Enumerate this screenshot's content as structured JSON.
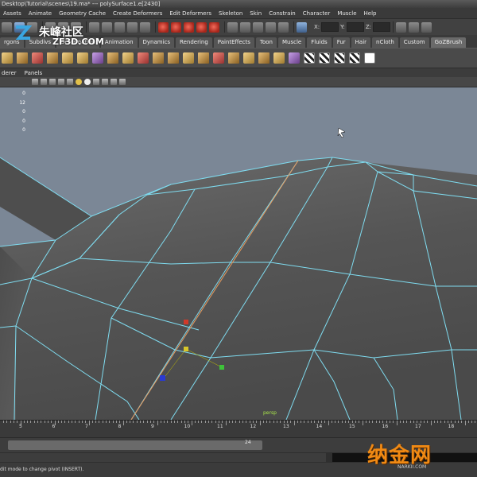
{
  "title": "Desktop\\Tutorial\\scenes\\19.ma*   ---   polySurface1.e[2430]",
  "menubar": {
    "items": [
      "Assets",
      "Animate",
      "Geometry Cache",
      "Create Deformers",
      "Edit Deformers",
      "Skeleton",
      "Skin",
      "Constrain",
      "Character",
      "Muscle",
      "Help"
    ]
  },
  "status": {
    "x_label": "X:",
    "y_label": "Y:",
    "z_label": "Z:"
  },
  "shelf_tabs": [
    "rgons",
    "Subdivs",
    "Deformation",
    "Animation",
    "Dynamics",
    "Rendering",
    "PaintEffects",
    "Toon",
    "Muscle",
    "Fluids",
    "Fur",
    "Hair",
    "nCloth",
    "Custom",
    "GoZBrush"
  ],
  "shelf_icons": [
    "y",
    "t",
    "r",
    "t",
    "y",
    "y",
    "v",
    "t",
    "y",
    "r",
    "t",
    "t",
    "y",
    "t",
    "r",
    "t",
    "y",
    "t",
    "y",
    "v",
    "c",
    "c",
    "c",
    "c",
    "w"
  ],
  "panel_menu": [
    "derer",
    "Panels"
  ],
  "hud_values": [
    "0",
    "12",
    "0",
    "0",
    "0"
  ],
  "viewport": {
    "camera_label": "persp"
  },
  "timeline": {
    "ticks": [
      "5",
      "6",
      "7",
      "8",
      "9",
      "10",
      "11",
      "12",
      "13",
      "14",
      "15",
      "16",
      "17",
      "18"
    ]
  },
  "range": {
    "current_value": "24"
  },
  "help_line": "dit mode to change pivot (INSERT).",
  "watermarks": {
    "top": "朱峰社区",
    "top_sub": "ZF3D.COM",
    "bottom": "纳金网",
    "bottom_sub": "NARKII.COM"
  },
  "colors": {
    "wire": "#7fdcf0",
    "viewport_bg": "#7b8796",
    "mesh": "#545454"
  }
}
